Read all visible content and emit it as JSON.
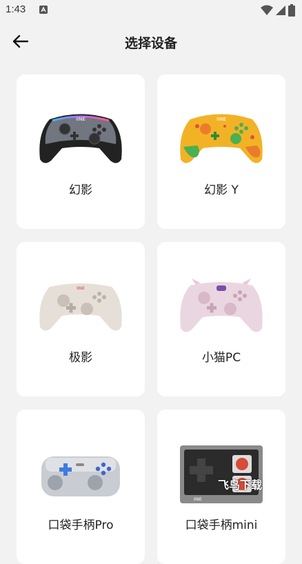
{
  "status_bar": {
    "time": "1:43"
  },
  "header": {
    "title": "选择设备"
  },
  "devices": [
    {
      "label": "幻影"
    },
    {
      "label": "幻影 Y"
    },
    {
      "label": "极影"
    },
    {
      "label": "小猫PC"
    },
    {
      "label": "口袋手柄Pro"
    },
    {
      "label": "口袋手柄mini"
    }
  ],
  "watermark": "飞鸟下载",
  "colors": {
    "background": "#f2f2f2",
    "card": "#ffffff",
    "text": "#222222"
  }
}
